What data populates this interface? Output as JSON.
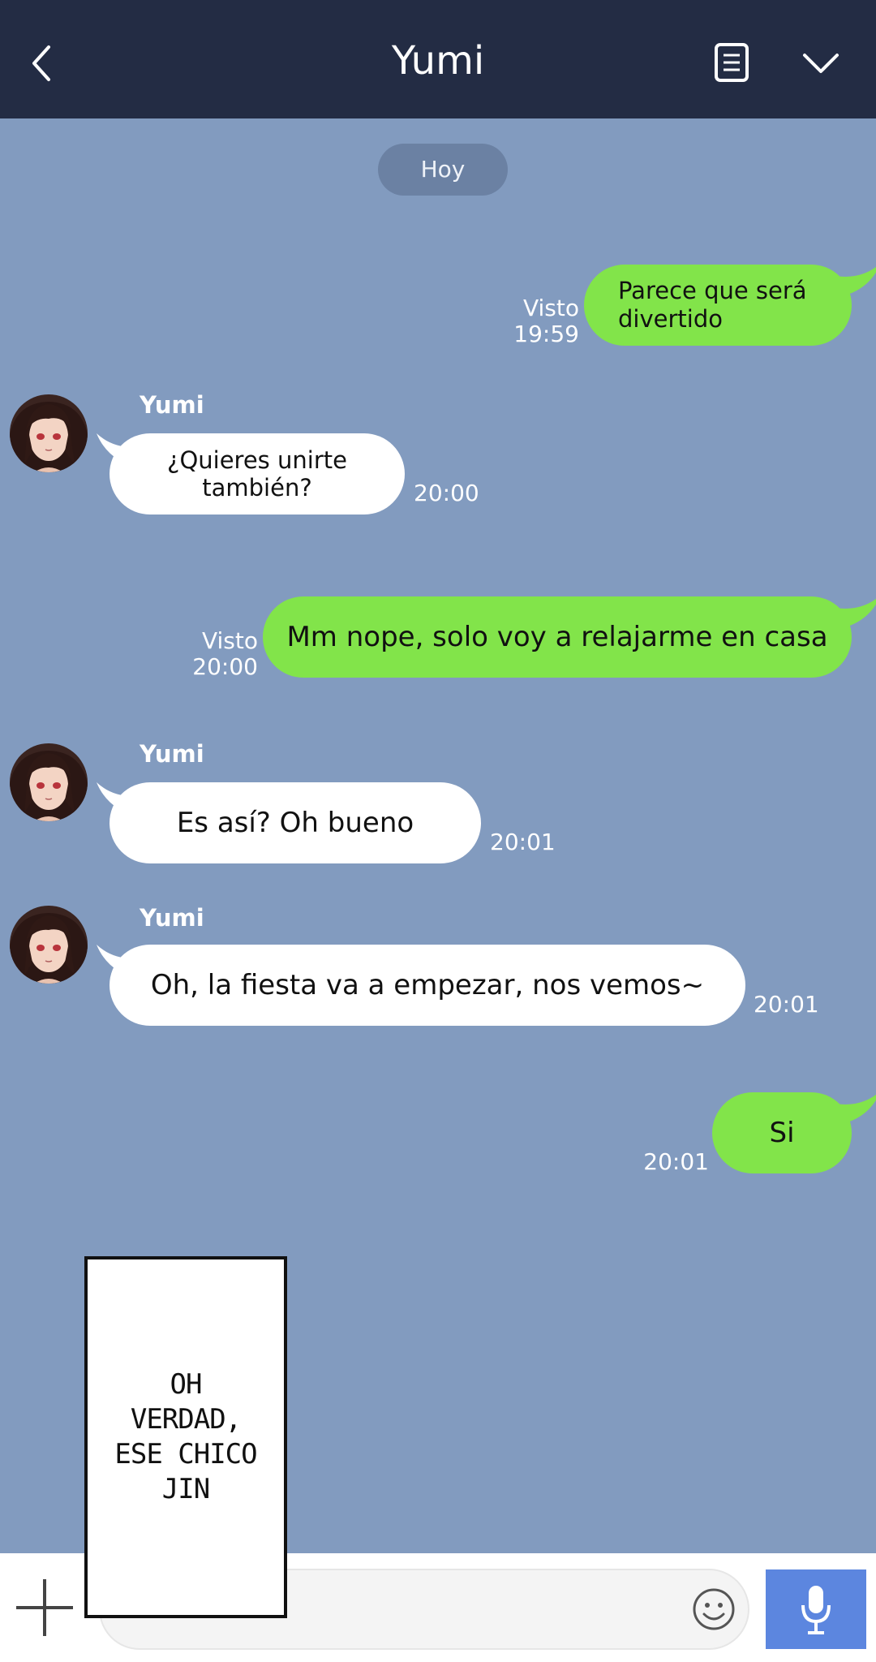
{
  "header": {
    "title": "Yumi",
    "back_icon": "back-chevron-icon",
    "notes_icon": "notes-icon",
    "menu_icon": "chevron-down-icon",
    "bg_color": "#232c44"
  },
  "chat": {
    "bg_color": "#829bbf",
    "date_separator": "Hoy",
    "messages": [
      {
        "sender": "me",
        "text": "Parece que será\ndivertido",
        "status": "Visto",
        "time": "19:59"
      },
      {
        "sender": "Yumi",
        "text": "¿Quieres unirte también?",
        "time": "20:00"
      },
      {
        "sender": "me",
        "text": "Mm nope, solo voy a relajarme en casa",
        "status": "Visto",
        "time": "20:00"
      },
      {
        "sender": "Yumi",
        "text": "Es así? Oh bueno",
        "time": "20:01"
      },
      {
        "sender": "Yumi",
        "text": "Oh, la fiesta va a empezar, nos vemos~",
        "time": "20:01"
      },
      {
        "sender": "me",
        "text": "Si",
        "time": "20:01"
      }
    ],
    "outgoing_color": "#82e44a",
    "incoming_color": "#ffffff"
  },
  "panel": {
    "text": "OH\nVERDAD,\nESE CHICO\nJIN"
  },
  "input": {
    "plus_icon": "plus-icon",
    "emoji_icon": "smiley-icon",
    "mic_icon": "microphone-icon",
    "mic_color": "#5c86df"
  }
}
